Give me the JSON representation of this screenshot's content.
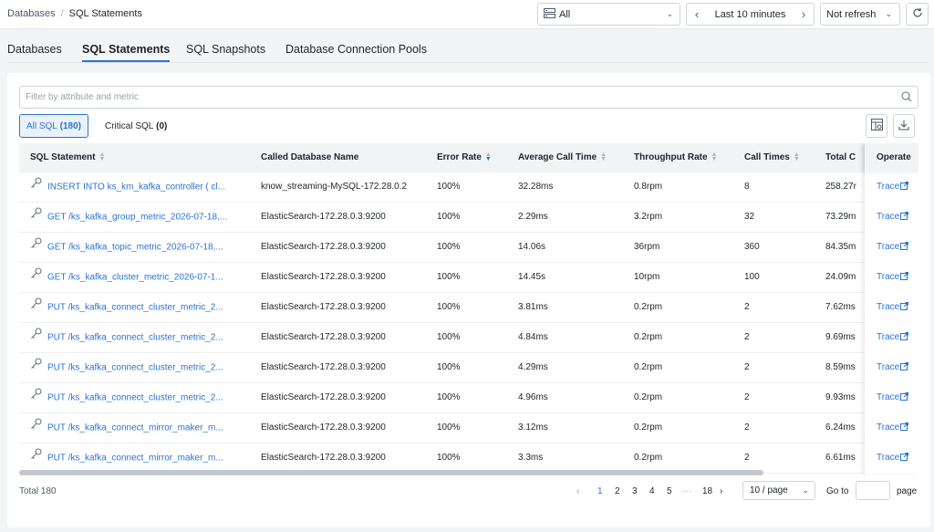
{
  "breadcrumb": {
    "root": "Databases",
    "separator": "/",
    "current": "SQL Statements"
  },
  "toolbar": {
    "environment": "All",
    "time_range": "Last 10 minutes",
    "refresh": "Not refresh"
  },
  "tabs": [
    "Databases",
    "SQL Statements",
    "SQL Snapshots",
    "Database Connection Pools"
  ],
  "active_tab": "SQL Statements",
  "filter": {
    "placeholder": "Filter by attribute and metric"
  },
  "segments": {
    "all_label": "All SQL",
    "all_count": "(180)",
    "critical_label": "Critical SQL",
    "critical_count": "(0)"
  },
  "table": {
    "columns": [
      "SQL Statement",
      "Called Database Name",
      "Error Rate",
      "Average Call Time",
      "Throughput Rate",
      "Call Times",
      "Total C",
      "Operate"
    ],
    "sorted_column": "Error Rate",
    "rows": [
      {
        "sql": "INSERT INTO ks_km_kafka_controller ( cl...",
        "db": "know_streaming-MySQL-172.28.0.2",
        "error_rate": "100%",
        "avg_time": "32.28ms",
        "throughput": "0.8rpm",
        "calls": "8",
        "total": "258.27r",
        "op": "Trace"
      },
      {
        "sql": "GET /ks_kafka_group_metric_2026-07-18,...",
        "db": "ElasticSearch-172.28.0.3:9200",
        "error_rate": "100%",
        "avg_time": "2.29ms",
        "throughput": "3.2rpm",
        "calls": "32",
        "total": "73.29m",
        "op": "Trace"
      },
      {
        "sql": "GET /ks_kafka_topic_metric_2026-07-18,...",
        "db": "ElasticSearch-172.28.0.3:9200",
        "error_rate": "100%",
        "avg_time": "14.06s",
        "throughput": "36rpm",
        "calls": "360",
        "total": "84.35m",
        "op": "Trace"
      },
      {
        "sql": "GET /ks_kafka_cluster_metric_2026-07-1...",
        "db": "ElasticSearch-172.28.0.3:9200",
        "error_rate": "100%",
        "avg_time": "14.45s",
        "throughput": "10rpm",
        "calls": "100",
        "total": "24.09m",
        "op": "Trace"
      },
      {
        "sql": "PUT /ks_kafka_connect_cluster_metric_2...",
        "db": "ElasticSearch-172.28.0.3:9200",
        "error_rate": "100%",
        "avg_time": "3.81ms",
        "throughput": "0.2rpm",
        "calls": "2",
        "total": "7.62ms",
        "op": "Trace"
      },
      {
        "sql": "PUT /ks_kafka_connect_cluster_metric_2...",
        "db": "ElasticSearch-172.28.0.3:9200",
        "error_rate": "100%",
        "avg_time": "4.84ms",
        "throughput": "0.2rpm",
        "calls": "2",
        "total": "9.69ms",
        "op": "Trace"
      },
      {
        "sql": "PUT /ks_kafka_connect_cluster_metric_2...",
        "db": "ElasticSearch-172.28.0.3:9200",
        "error_rate": "100%",
        "avg_time": "4.29ms",
        "throughput": "0.2rpm",
        "calls": "2",
        "total": "8.59ms",
        "op": "Trace"
      },
      {
        "sql": "PUT /ks_kafka_connect_cluster_metric_2...",
        "db": "ElasticSearch-172.28.0.3:9200",
        "error_rate": "100%",
        "avg_time": "4.96ms",
        "throughput": "0.2rpm",
        "calls": "2",
        "total": "9.93ms",
        "op": "Trace"
      },
      {
        "sql": "PUT /ks_kafka_connect_mirror_maker_m...",
        "db": "ElasticSearch-172.28.0.3:9200",
        "error_rate": "100%",
        "avg_time": "3.12ms",
        "throughput": "0.2rpm",
        "calls": "2",
        "total": "6.24ms",
        "op": "Trace"
      },
      {
        "sql": "PUT /ks_kafka_connect_mirror_maker_m...",
        "db": "ElasticSearch-172.28.0.3:9200",
        "error_rate": "100%",
        "avg_time": "3.3ms",
        "throughput": "0.2rpm",
        "calls": "2",
        "total": "6.61ms",
        "op": "Trace"
      }
    ]
  },
  "footer": {
    "total": "Total 180",
    "pages": [
      "1",
      "2",
      "3",
      "4",
      "5",
      "···",
      "18"
    ],
    "current_page": "1",
    "page_size": "10 / page",
    "goto_label": "Go to",
    "page_label": "page"
  },
  "colors": {
    "accent": "#2b73d6",
    "header_bg": "#f2f3f5",
    "page_bg": "#f3f4f6"
  },
  "icons": [
    "environment-icon",
    "chevron-down-icon",
    "chevron-left-icon",
    "chevron-right-icon",
    "reload-icon",
    "search-icon",
    "column-settings-icon",
    "download-icon",
    "key-icon",
    "external-link-icon"
  ]
}
